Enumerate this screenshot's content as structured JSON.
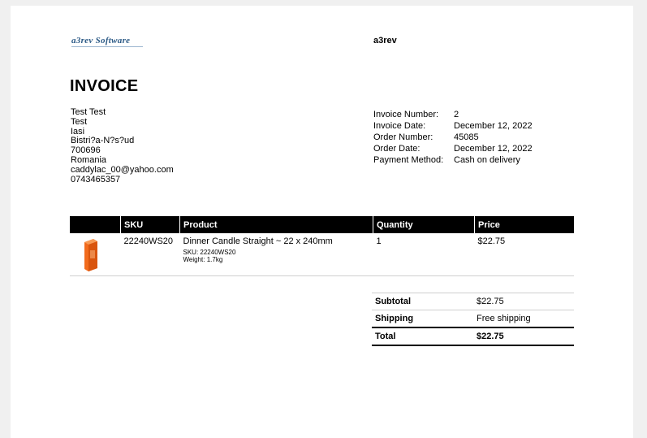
{
  "header": {
    "logo_text": "a3rev Software",
    "shop_name": "a3rev"
  },
  "title": "INVOICE",
  "billing_address": [
    "Test Test",
    "Test",
    "Iasi",
    "Bistri?a-N?s?ud",
    "700696",
    "Romania",
    "caddylac_00@yahoo.com",
    "0743465357"
  ],
  "order_info": [
    {
      "label": "Invoice Number:",
      "value": "2"
    },
    {
      "label": "Invoice Date:",
      "value": "December 12, 2022"
    },
    {
      "label": "Order Number:",
      "value": "45085"
    },
    {
      "label": "Order Date:",
      "value": "December 12, 2022"
    },
    {
      "label": "Payment Method:",
      "value": "Cash on delivery"
    }
  ],
  "items_table": {
    "headers": [
      "",
      "SKU",
      "Product",
      "Quantity",
      "Price"
    ],
    "rows": [
      {
        "image_icon": "candle-box-icon",
        "sku": "22240WS20",
        "product": "Dinner Candle Straight ~ 22 x 240mm",
        "sku_detail": "SKU:  22240WS20",
        "weight_detail": "Weight:  1.7kg",
        "quantity": "1",
        "price": "$22.75"
      }
    ]
  },
  "totals": [
    {
      "label": "Subtotal",
      "value": "$22.75"
    },
    {
      "label": "Shipping",
      "value": "Free shipping"
    },
    {
      "label": "Total",
      "value": "$22.75"
    }
  ],
  "colors": {
    "logo": "#2c5a86",
    "header_bg": "#000000",
    "product_orange": "#f26b1d"
  }
}
